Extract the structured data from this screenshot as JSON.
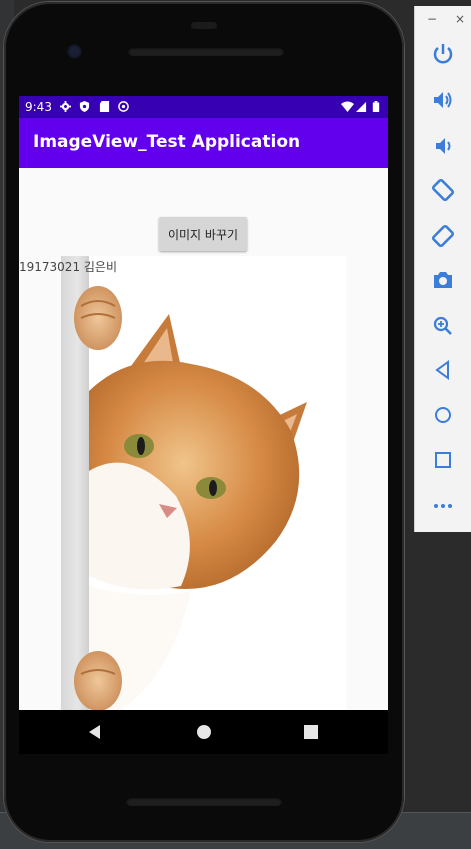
{
  "status_bar": {
    "time": "9:43",
    "icons": [
      "settings-icon",
      "shield-icon",
      "sd-card-icon",
      "accessibility-icon",
      "wifi-icon",
      "signal-icon",
      "battery-icon"
    ]
  },
  "app_bar": {
    "title": "ImageView_Test Application"
  },
  "content": {
    "button_label": "이미지 바꾸기",
    "student_label": "19173021 김은비",
    "image": "cat-peeking-image"
  },
  "navigation": [
    "back-icon",
    "home-icon",
    "recents-icon"
  ],
  "emulator_panel": {
    "window_controls": [
      "−",
      "×"
    ],
    "buttons": [
      "power-icon",
      "volume-up-icon",
      "volume-down-icon",
      "rotate-left-icon",
      "rotate-right-icon",
      "camera-icon",
      "zoom-icon",
      "back-icon",
      "home-icon",
      "overview-icon",
      "more-icon"
    ]
  },
  "colors": {
    "status_bar": "#3700b3",
    "app_bar": "#6200ee",
    "emulator_icons": "#3b7dd8"
  }
}
